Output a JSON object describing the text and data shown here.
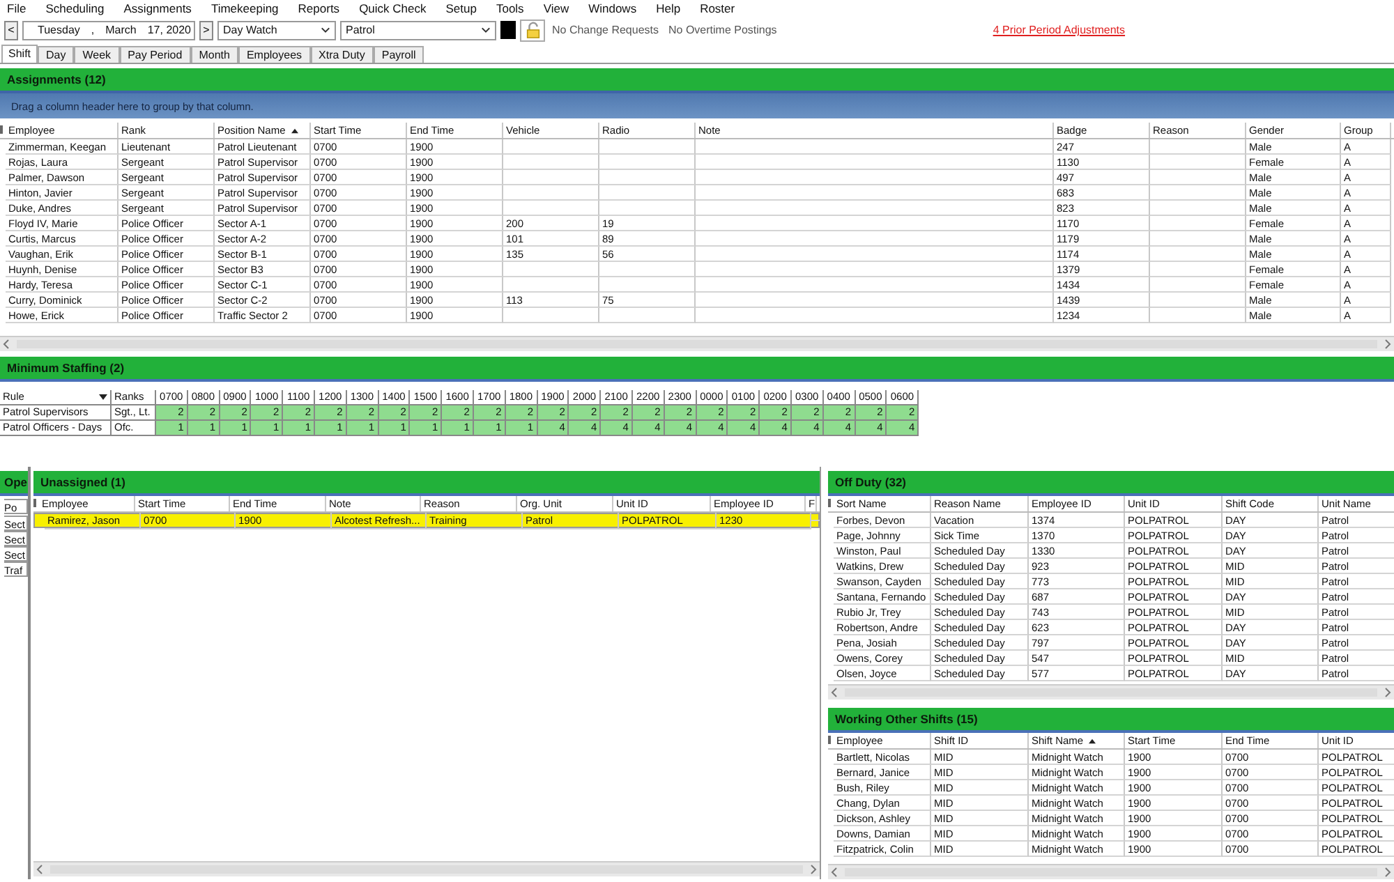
{
  "menu": [
    "File",
    "Scheduling",
    "Assignments",
    "Timekeeping",
    "Reports",
    "Quick Check",
    "Setup",
    "Tools",
    "View",
    "Windows",
    "Help",
    "Roster"
  ],
  "toolbar": {
    "date_parts": [
      "Tuesday",
      ",",
      "March",
      "17, 2020"
    ],
    "prev": "<",
    "next": ">",
    "shift": "Day Watch",
    "unit": "Patrol",
    "status": [
      "No Change Requests",
      "No Overtime Postings"
    ],
    "link": "4 Prior Period Adjustments"
  },
  "tabs": [
    {
      "label": "Shift",
      "selected": true
    },
    {
      "label": "Day",
      "selected": false
    },
    {
      "label": "Week",
      "selected": false
    },
    {
      "label": "Pay Period",
      "selected": false
    },
    {
      "label": "Month",
      "selected": false
    },
    {
      "label": "Employees",
      "selected": false
    },
    {
      "label": "Xtra Duty",
      "selected": false
    },
    {
      "label": "Payroll",
      "selected": false
    }
  ],
  "assignments": {
    "title": "Assignments (12)",
    "group_hint": "Drag a column header here to group by that column.",
    "columns": [
      {
        "label": "Employee",
        "sorted": false
      },
      {
        "label": "Rank",
        "sorted": false
      },
      {
        "label": "Position Name",
        "sorted": true
      },
      {
        "label": "Start Time",
        "sorted": false
      },
      {
        "label": "End Time",
        "sorted": false
      },
      {
        "label": "Vehicle",
        "sorted": false
      },
      {
        "label": "Radio",
        "sorted": false
      },
      {
        "label": "Note",
        "sorted": false
      },
      {
        "label": "Badge",
        "sorted": false
      },
      {
        "label": "Reason",
        "sorted": false
      },
      {
        "label": "Gender",
        "sorted": false
      },
      {
        "label": "Group",
        "sorted": false
      }
    ],
    "rows": [
      [
        "Zimmerman, Keegan",
        "Lieutenant",
        "Patrol Lieutenant",
        "0700",
        "1900",
        null,
        null,
        null,
        "247",
        null,
        "Male",
        "A"
      ],
      [
        "Rojas, Laura",
        "Sergeant",
        "Patrol Supervisor",
        "0700",
        "1900",
        null,
        null,
        null,
        "1130",
        null,
        "Female",
        "A"
      ],
      [
        "Palmer, Dawson",
        "Sergeant",
        "Patrol Supervisor",
        "0700",
        "1900",
        null,
        null,
        null,
        "497",
        null,
        "Male",
        "A"
      ],
      [
        "Hinton, Javier",
        "Sergeant",
        "Patrol Supervisor",
        "0700",
        "1900",
        null,
        null,
        null,
        "683",
        null,
        "Male",
        "A"
      ],
      [
        "Duke, Andres",
        "Sergeant",
        "Patrol Supervisor",
        "0700",
        "1900",
        null,
        null,
        null,
        "823",
        null,
        "Male",
        "A"
      ],
      [
        "Floyd IV, Marie",
        "Police Officer",
        "Sector A-1",
        "0700",
        "1900",
        "200",
        "19",
        null,
        "1170",
        null,
        "Female",
        "A"
      ],
      [
        "Curtis, Marcus",
        "Police Officer",
        "Sector A-2",
        "0700",
        "1900",
        "101",
        "89",
        null,
        "1179",
        null,
        "Male",
        "A"
      ],
      [
        "Vaughan, Erik",
        "Police Officer",
        "Sector B-1",
        "0700",
        "1900",
        "135",
        "56",
        null,
        "1174",
        null,
        "Male",
        "A"
      ],
      [
        "Huynh, Denise",
        "Police Officer",
        "Sector B3",
        "0700",
        "1900",
        null,
        null,
        null,
        "1379",
        null,
        "Female",
        "A"
      ],
      [
        "Hardy, Teresa",
        "Police Officer",
        "Sector C-1",
        "0700",
        "1900",
        null,
        null,
        null,
        "1434",
        null,
        "Female",
        "A"
      ],
      [
        "Curry, Dominick",
        "Police Officer",
        "Sector C-2",
        "0700",
        "1900",
        "113",
        "75",
        null,
        "1439",
        null,
        "Male",
        "A"
      ],
      [
        "Howe, Erick",
        "Police Officer",
        "Traffic Sector 2",
        "0700",
        "1900",
        null,
        null,
        null,
        "1234",
        null,
        "Male",
        "A"
      ]
    ]
  },
  "minimum_staffing": {
    "title": "Minimum Staffing (2)",
    "rule_label": "Rule",
    "ranks_label": "Ranks",
    "hours": [
      "0700",
      "0800",
      "0900",
      "1000",
      "1100",
      "1200",
      "1300",
      "1400",
      "1500",
      "1600",
      "1700",
      "1800",
      "1900",
      "2000",
      "2100",
      "2200",
      "2300",
      "0000",
      "0100",
      "0200",
      "0300",
      "0400",
      "0500",
      "0600"
    ],
    "rows": [
      {
        "rule": "Patrol Supervisors",
        "ranks": "Sgt., Lt.",
        "values": [
          "2",
          "2",
          "2",
          "2",
          "2",
          "2",
          "2",
          "2",
          "2",
          "2",
          "2",
          "2",
          "2",
          "2",
          "2",
          "2",
          "2",
          "2",
          "2",
          "2",
          "2",
          "2",
          "2",
          "2"
        ]
      },
      {
        "rule": "Patrol Officers - Days",
        "ranks": "Ofc.",
        "values": [
          "1",
          "1",
          "1",
          "1",
          "1",
          "1",
          "1",
          "1",
          "1",
          "1",
          "1",
          "1",
          "4",
          "4",
          "4",
          "4",
          "4",
          "4",
          "4",
          "4",
          "4",
          "4",
          "4",
          "4"
        ]
      }
    ]
  },
  "side_panel": {
    "title": "Ope",
    "column": "Po",
    "rows": [
      "Sect",
      "Sect",
      "Sect",
      "Traf"
    ]
  },
  "unassigned": {
    "title": "Unassigned (1)",
    "columns": [
      {
        "label": "Employee"
      },
      {
        "label": "Start Time"
      },
      {
        "label": "End Time"
      },
      {
        "label": "Note"
      },
      {
        "label": "Reason"
      },
      {
        "label": "Org. Unit"
      },
      {
        "label": "Unit ID"
      },
      {
        "label": "Employee ID"
      },
      {
        "label": "F"
      }
    ],
    "rows": [
      {
        "cells": [
          "Ramirez, Jason",
          "0700",
          "1900",
          "Alcotest Refresh...",
          "Training",
          "Patrol",
          "POLPATROL",
          "1230",
          null
        ],
        "selected": true
      }
    ]
  },
  "off_duty": {
    "title": "Off Duty (32)",
    "columns": [
      {
        "label": "Sort Name"
      },
      {
        "label": "Reason Name"
      },
      {
        "label": "Employee ID"
      },
      {
        "label": "Unit ID"
      },
      {
        "label": "Shift Code"
      },
      {
        "label": "Unit Name"
      }
    ],
    "rows": [
      [
        "Forbes, Devon",
        "Vacation",
        "1374",
        "POLPATROL",
        "DAY",
        "Patrol"
      ],
      [
        "Page, Johnny",
        "Sick Time",
        "1370",
        "POLPATROL",
        "DAY",
        "Patrol"
      ],
      [
        "Winston, Paul",
        "Scheduled Day",
        "1330",
        "POLPATROL",
        "DAY",
        "Patrol"
      ],
      [
        "Watkins, Drew",
        "Scheduled Day",
        "923",
        "POLPATROL",
        "MID",
        "Patrol"
      ],
      [
        "Swanson, Cayden",
        "Scheduled Day",
        "773",
        "POLPATROL",
        "MID",
        "Patrol"
      ],
      [
        "Santana, Fernando",
        "Scheduled Day",
        "687",
        "POLPATROL",
        "DAY",
        "Patrol"
      ],
      [
        "Rubio Jr, Trey",
        "Scheduled Day",
        "743",
        "POLPATROL",
        "MID",
        "Patrol"
      ],
      [
        "Robertson, Andre",
        "Scheduled Day",
        "623",
        "POLPATROL",
        "DAY",
        "Patrol"
      ],
      [
        "Pena, Josiah",
        "Scheduled Day",
        "797",
        "POLPATROL",
        "DAY",
        "Patrol"
      ],
      [
        "Owens, Corey",
        "Scheduled Day",
        "547",
        "POLPATROL",
        "MID",
        "Patrol"
      ],
      [
        "Olsen, Joyce",
        "Scheduled Day",
        "577",
        "POLPATROL",
        "DAY",
        "Patrol"
      ]
    ]
  },
  "working_other_shifts": {
    "title": "Working Other Shifts (15)",
    "columns": [
      {
        "label": "Employee",
        "sorted": false
      },
      {
        "label": "Shift ID",
        "sorted": false
      },
      {
        "label": "Shift Name",
        "sorted": true
      },
      {
        "label": "Start Time",
        "sorted": false
      },
      {
        "label": "End Time",
        "sorted": false
      },
      {
        "label": "Unit ID",
        "sorted": false
      }
    ],
    "rows": [
      [
        "Bartlett, Nicolas",
        "MID",
        "Midnight Watch",
        "1900",
        "0700",
        "POLPATROL"
      ],
      [
        "Bernard, Janice",
        "MID",
        "Midnight Watch",
        "1900",
        "0700",
        "POLPATROL"
      ],
      [
        "Bush, Riley",
        "MID",
        "Midnight Watch",
        "1900",
        "0700",
        "POLPATROL"
      ],
      [
        "Chang, Dylan",
        "MID",
        "Midnight Watch",
        "1900",
        "0700",
        "POLPATROL"
      ],
      [
        "Dickson, Ashley",
        "MID",
        "Midnight Watch",
        "1900",
        "0700",
        "POLPATROL"
      ],
      [
        "Downs, Damian",
        "MID",
        "Midnight Watch",
        "1900",
        "0700",
        "POLPATROL"
      ],
      [
        "Fitzpatrick, Colin",
        "MID",
        "Midnight Watch",
        "1900",
        "0700",
        "POLPATROL"
      ]
    ]
  }
}
